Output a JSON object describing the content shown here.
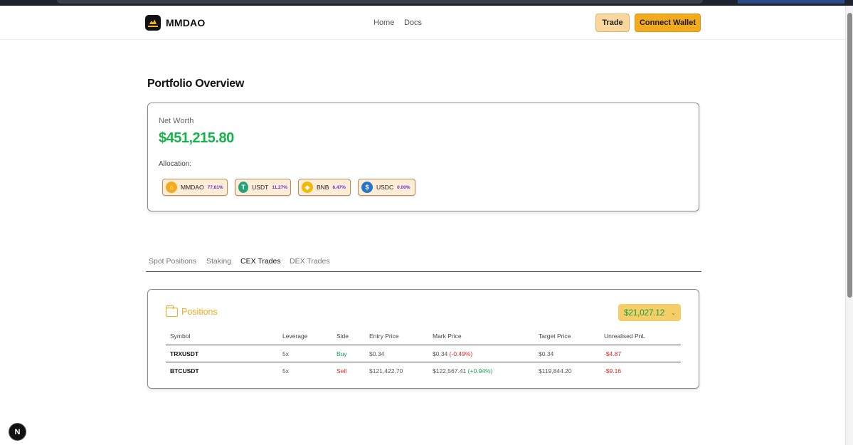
{
  "header": {
    "brand": "MMDAO",
    "nav": {
      "home": "Home",
      "docs": "Docs"
    },
    "trade_label": "Trade",
    "connect_label": "Connect Wallet"
  },
  "page": {
    "title": "Portfolio Overview"
  },
  "networth": {
    "label": "Net Worth",
    "value": "$451,215.80",
    "allocation_label": "Allocation:",
    "allocation": [
      {
        "symbol": "MMDAO",
        "pct": "77.61%",
        "icon": "mmdao-coin-icon",
        "color": "#f2ab1c"
      },
      {
        "symbol": "USDT",
        "pct": "11.27%",
        "icon": "usdt-coin-icon",
        "color": "#26a17b"
      },
      {
        "symbol": "BNB",
        "pct": "6.47%",
        "icon": "bnb-coin-icon",
        "color": "#f0b90b"
      },
      {
        "symbol": "USDC",
        "pct": "0.00%",
        "icon": "usdc-coin-icon",
        "color": "#2775ca"
      }
    ]
  },
  "tabs": {
    "spot": "Spot Positions",
    "staking": "Staking",
    "cex": "CEX Trades",
    "dex": "DEX Trades",
    "active": "CEX Trades"
  },
  "positions": {
    "title": "Positions",
    "balance": "$21,027.12",
    "columns": [
      "Symbol",
      "Leverage",
      "Side",
      "Entry Price",
      "Mark Price",
      "Target Price",
      "Unrealised PnL"
    ],
    "rows": [
      {
        "symbol": "TRXUSDT",
        "leverage": "5x",
        "side": "Buy",
        "entry": "$0.34",
        "mark": "$0.34",
        "mark_change": "(-0.49%)",
        "target": "$0.34",
        "pnl": "-$4.87"
      },
      {
        "symbol": "BTCUSDT",
        "leverage": "5x",
        "side": "Sell",
        "entry": "$121,422.70",
        "mark": "$122,567.41",
        "mark_change": "(+0.94%)",
        "target": "$119,844.20",
        "pnl": "-$9.16"
      }
    ]
  },
  "badge": {
    "letter": "N"
  },
  "colors": {
    "accent": "#f2ab1c",
    "positive": "#16a34a",
    "negative": "#dc2626",
    "percent": "#6a2fd6"
  }
}
